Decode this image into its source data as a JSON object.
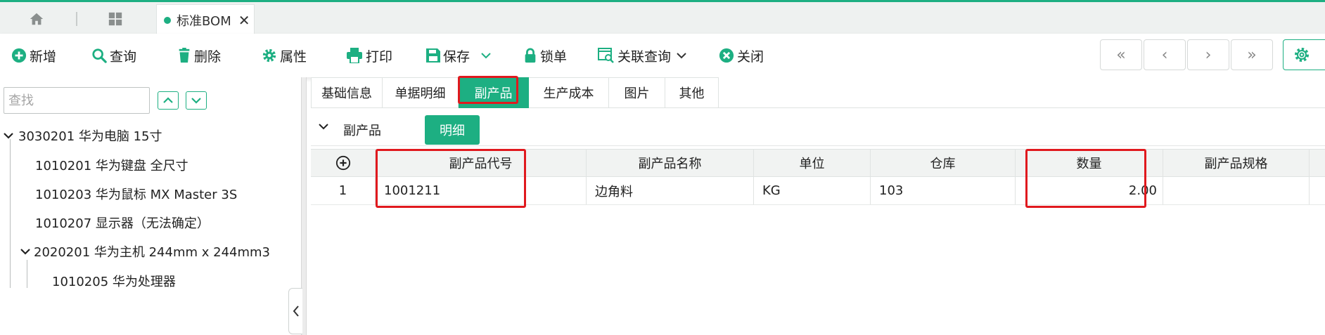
{
  "colors": {
    "accent": "#1daf82",
    "highlight": "#e0191e"
  },
  "top_tabs": {
    "home_icon": "home-icon",
    "apps_icon": "grid-icon",
    "doc_tab_title": "标准BOM",
    "close_glyph": "✕"
  },
  "toolbar": {
    "add": "新增",
    "query": "查询",
    "delete": "删除",
    "properties": "属性",
    "print": "打印",
    "save": "保存",
    "lock": "锁单",
    "related_query": "关联查询",
    "close": "关闭",
    "nav": {
      "first": "«",
      "prev": "‹",
      "next": "›",
      "last": "»"
    }
  },
  "left_panel": {
    "search_placeholder": "查找",
    "tree": [
      {
        "label": "3030201 华为电脑 15寸",
        "expanded": true
      },
      {
        "label": "1010201 华为键盘 全尺寸"
      },
      {
        "label": "1010203 华为鼠标 MX Master 3S"
      },
      {
        "label": "1010207 显示器（无法确定）"
      },
      {
        "label": "2020201 华为主机 244mm x 244mm3",
        "expanded": true
      },
      {
        "label": "1010205 华为处理器"
      }
    ]
  },
  "right_panel": {
    "tabs": [
      "基础信息",
      "单据明细",
      "副产品",
      "生产成本",
      "图片",
      "其他"
    ],
    "active_tab": "副产品",
    "section_title": "副产品",
    "detail_button": "明细",
    "grid": {
      "headers": [
        "副产品代号",
        "副产品名称",
        "单位",
        "仓库",
        "数量",
        "副产品规格"
      ],
      "rows": [
        {
          "index": "1",
          "code": "1001211",
          "name": "边角料",
          "unit": "KG",
          "warehouse": "103",
          "quantity": "2.00",
          "spec": ""
        }
      ]
    }
  }
}
